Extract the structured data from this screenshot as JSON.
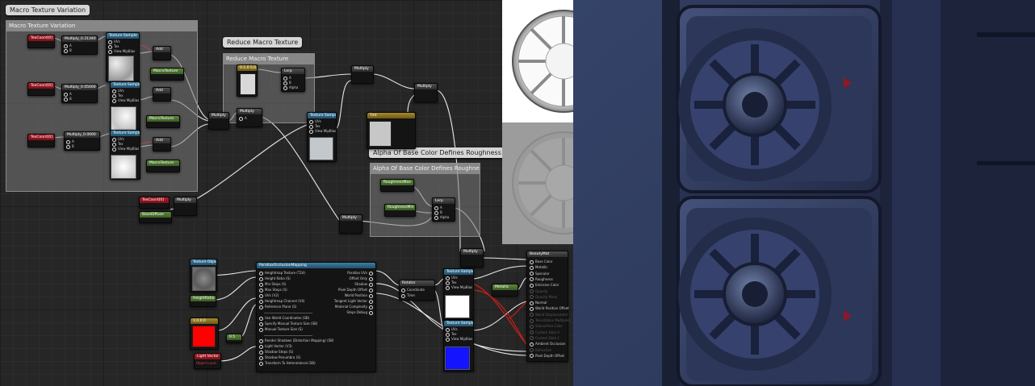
{
  "comments": {
    "macro": {
      "bubble": "Macro Texture Variation",
      "title": "Macro Texture Variation"
    },
    "reduce": {
      "bubble": "Reduce Macro Texture",
      "title": "Reduce Macro Texture"
    },
    "alpha": {
      "bubble": "Alpha Of Base Color Defines Roughness",
      "title": "Alpha Of Base Color Defines Roughness"
    }
  },
  "nodes": {
    "texcoord1": "TexCoord[0]",
    "texcoord2": "TexCoord[0]",
    "texcoord3": "TexCoord[0]",
    "mult1": "Multiply_0.21340",
    "mult2": "Multiply_0.05000",
    "mult3": "Multiply_0.0000",
    "texsample": "Texture Sample",
    "add": "Add",
    "macroparam1": "MacroTexture",
    "macroparam2": "MacroTexture",
    "macroparam3": "MacroTexture",
    "multiply": "Multiply",
    "reduce_const": "0.1,0.5,0.5",
    "lerp": "Lerp",
    "lerp_a": "A",
    "lerp_b": "B",
    "lerp_alpha": "Alpha",
    "basecolor_param": "Tint",
    "roughness_max": "RoughnessMax",
    "roughness_min": "RoughnessMin",
    "basediffuse": "BaseDiffuse",
    "texobject": "Texture Object",
    "heightratio": "HeightRatio",
    "const_color": "1,0,0,0",
    "constant": "0.5",
    "lightvector": "Light Vector",
    "lightvector_sub": "Object Local",
    "rotator": "Rotator",
    "rotator_coord": "Coordinate",
    "rotator_time": "Time",
    "metallic": "Metallic",
    "pin_uvs": "UVs",
    "pin_tex": "Tex",
    "pin_view": "View MipBias",
    "pin_a": "A",
    "pin_b": "B"
  },
  "pom": {
    "title": "ParallaxOcclusionMapping",
    "inputs": [
      "Heightmap Texture (T2d)",
      "Height Ratio (S)",
      "Min Steps (S)",
      "Max Steps (S)",
      "UVs (V2)",
      "Heightmap Channel (V4)",
      "Reference Plane (S)",
      "",
      "Use World Coordinates (SB)",
      "Specify Manual Texture Size (SB)",
      "Manual Texture Size (S)",
      "",
      "Render Shadows (Distortion Mapping) (SB)",
      "Light Vector (V3)",
      "Shadow Steps (S)",
      "Shadow Penumbra (S)",
      "Transform To Heterolateral (SB)"
    ],
    "outputs": [
      "Parallax UVs",
      "Offset Only",
      "Shadow",
      "Pixel Depth Offset",
      "World Position",
      "Tangent Light Vector",
      "Material Complexity",
      "Steps Debug"
    ]
  },
  "result": {
    "title": "BeautyMat",
    "pins": [
      "Base Color",
      "Metallic",
      "Specular",
      "Roughness",
      "Emissive Color",
      "Opacity",
      "Opacity Mask",
      "Normal",
      "World Position Offset",
      "World Displacement",
      "Tessellation Multiplier",
      "Subsurface Color",
      "Custom Data 0",
      "Custom Data 1",
      "Ambient Occlusion",
      "Refraction",
      "Pixel Depth Offset"
    ],
    "active": [
      true,
      true,
      true,
      true,
      true,
      false,
      false,
      true,
      true,
      false,
      false,
      false,
      false,
      false,
      true,
      false,
      true
    ]
  },
  "colors": {
    "texcoord_header": "#b01e2a",
    "param_header": "#5c8a3a",
    "texsample_header": "#3b7fa5",
    "const_red": "#ff0000",
    "const_blue": "#1414ff",
    "preview_bg": "#ffffff",
    "scene_tint": "#2b3658"
  }
}
